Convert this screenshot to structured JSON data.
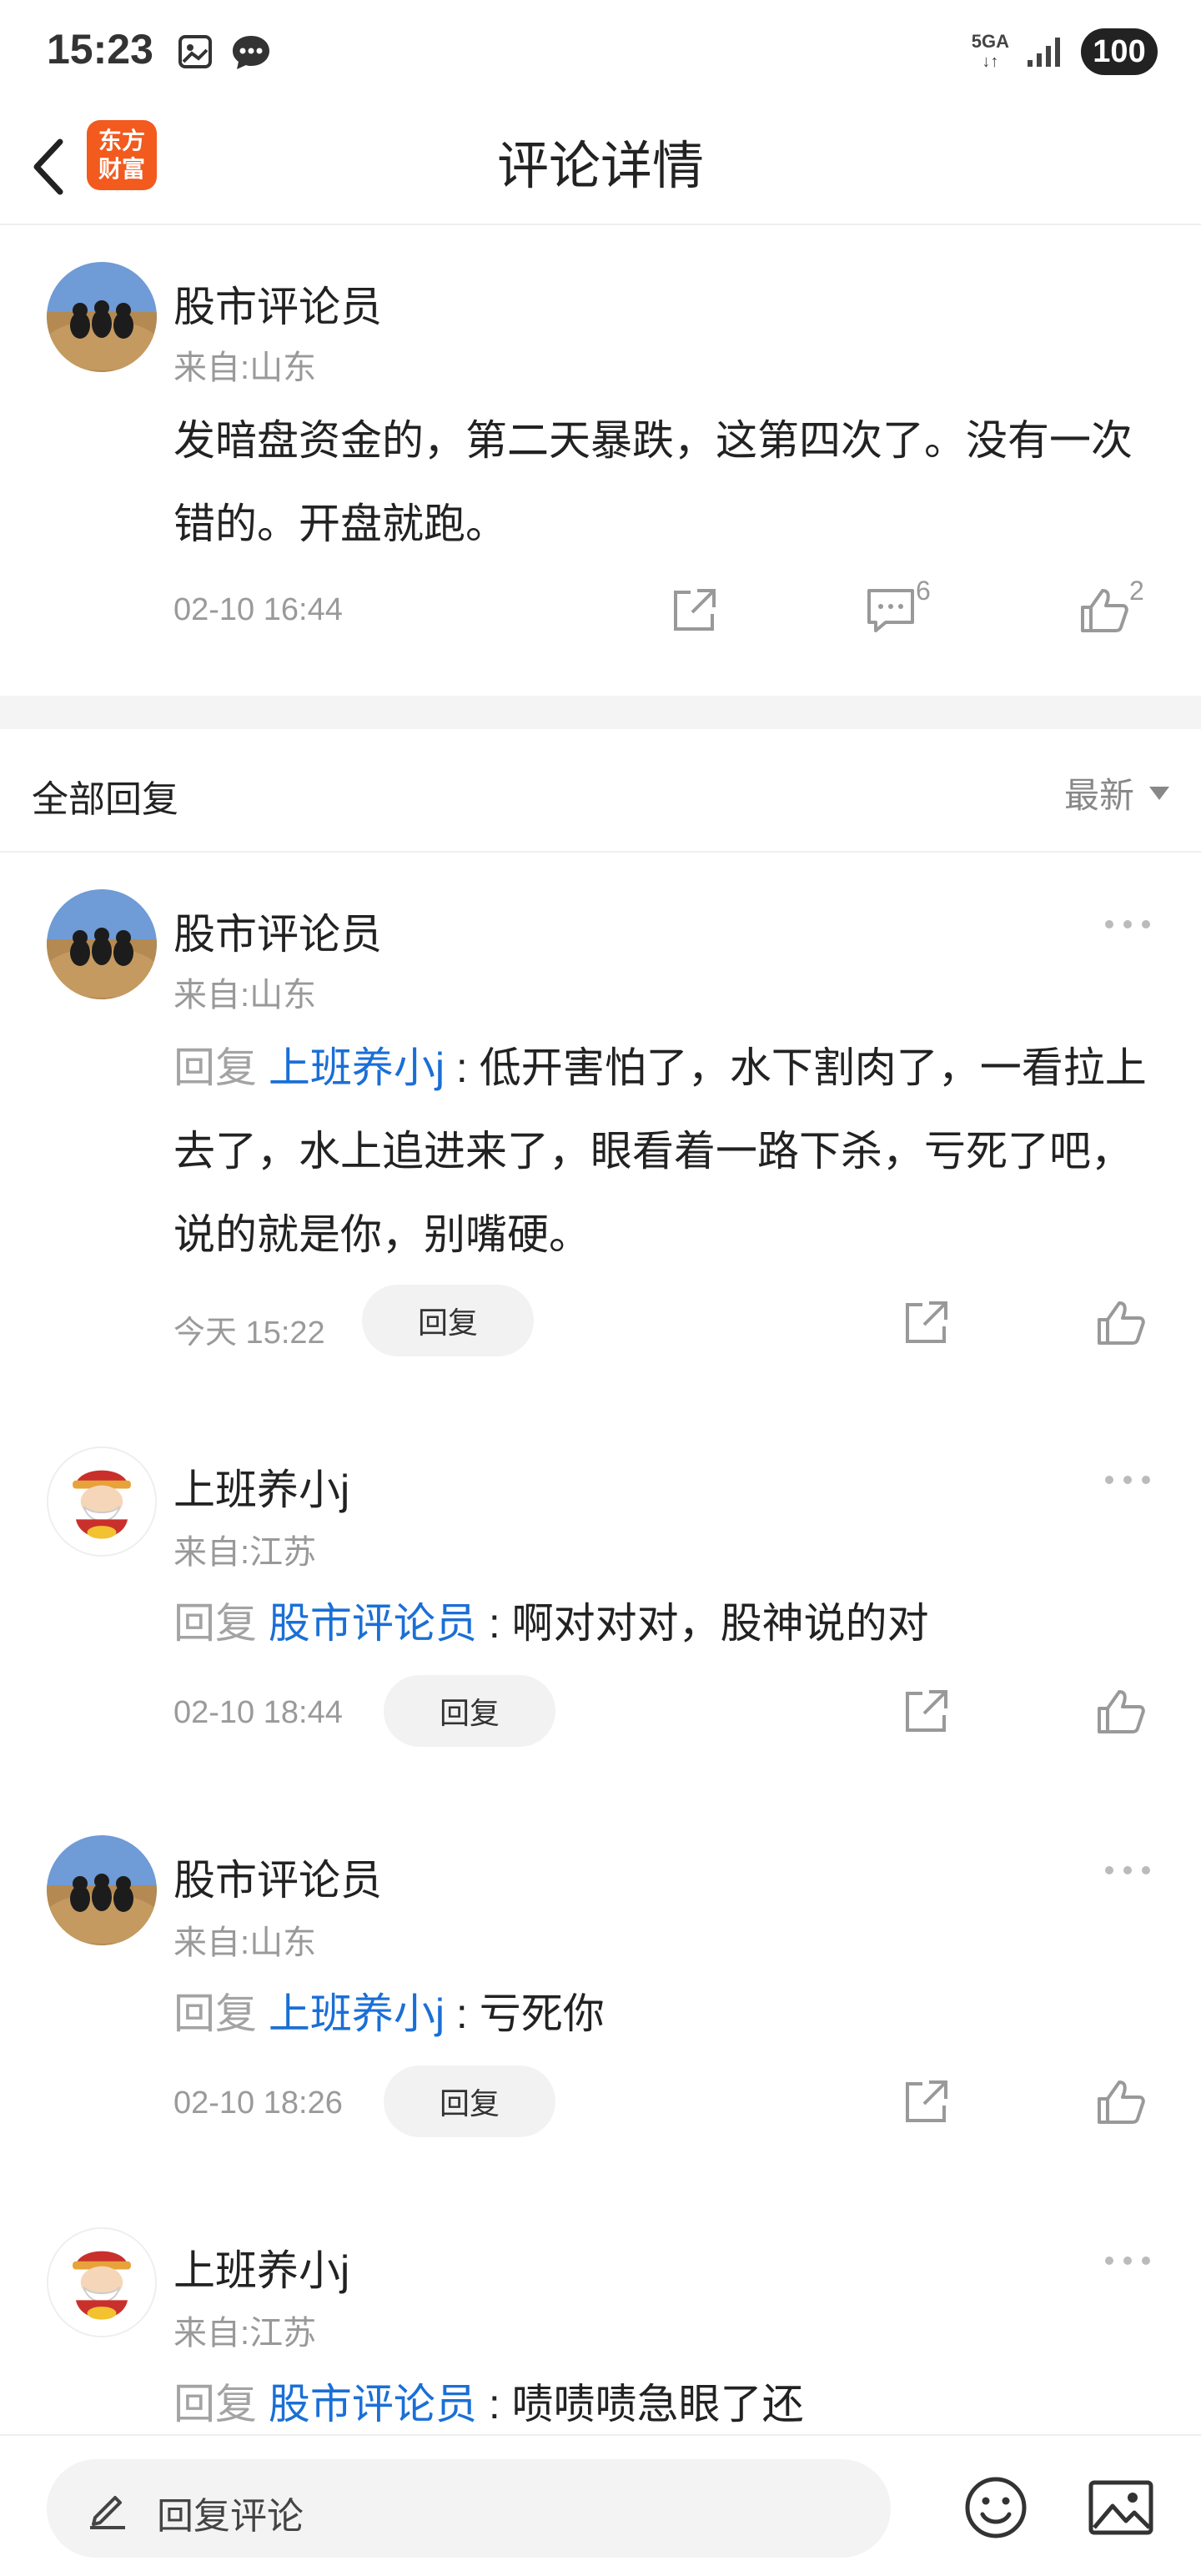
{
  "status_bar": {
    "time": "15:23",
    "network": "5GA",
    "battery": "100"
  },
  "nav": {
    "title": "评论详情",
    "logo_line1": "东方",
    "logo_line2": "财富"
  },
  "post": {
    "author": "股市评论员",
    "location": "来自:山东",
    "text": "发暗盘资金的，第二天暴跌，这第四次了。没有一次错的。开盘就跑。",
    "time": "02-10 16:44",
    "comment_count": "6",
    "like_count": "2"
  },
  "replies_section": {
    "title": "全部回复",
    "sort_label": "最新"
  },
  "replies": [
    {
      "author": "股市评论员",
      "location": "来自:山东",
      "prefix": "回复",
      "target": "上班养小j",
      "sep": ":",
      "text": "低开害怕了，水下割肉了，一看拉上去了，水上追进来了，眼看着一路下杀，亏死了吧，说的就是你，别嘴硬。",
      "time": "今天 15:22",
      "reply_label": "回复"
    },
    {
      "author": "上班养小j",
      "location": "来自:江苏",
      "prefix": "回复",
      "target": "股市评论员",
      "sep": ":",
      "text": "啊对对对，股神说的对",
      "time": "02-10 18:44",
      "reply_label": "回复"
    },
    {
      "author": "股市评论员",
      "location": "来自:山东",
      "prefix": "回复",
      "target": "上班养小j",
      "sep": ":",
      "text": "亏死你",
      "time": "02-10 18:26",
      "reply_label": "回复"
    },
    {
      "author": "上班养小j",
      "location": "来自:江苏",
      "prefix": "回复",
      "target": "股市评论员",
      "sep": ":",
      "text": "啧啧啧急眼了还"
    }
  ],
  "bottom_bar": {
    "input_placeholder": "回复评论"
  },
  "colors": {
    "brand": "#f25a1e",
    "link": "#1a6fd6",
    "muted": "#999999"
  },
  "icons": [
    "back-arrow-icon",
    "share-icon",
    "comment-icon",
    "like-icon",
    "more-icon",
    "pen-icon",
    "emoji-icon",
    "image-icon"
  ]
}
